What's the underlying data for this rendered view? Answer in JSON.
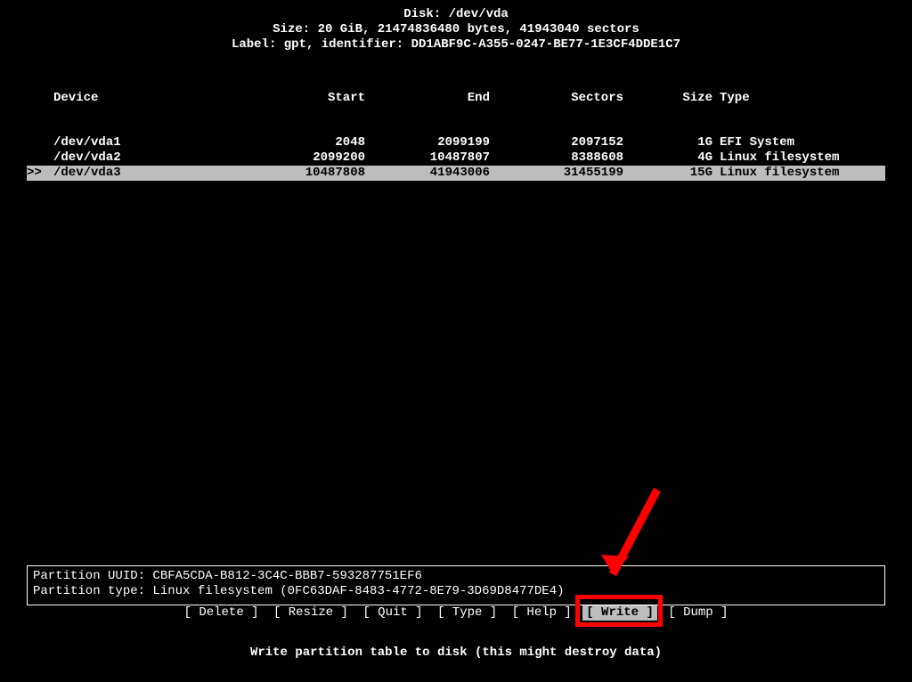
{
  "header": {
    "disk_line": "Disk: /dev/vda",
    "size_line": "Size: 20 GiB, 21474836480 bytes, 41943040 sectors",
    "label_line": "Label: gpt, identifier: DD1ABF9C-A355-0247-BE77-1E3CF4DDE1C7"
  },
  "columns": {
    "device": "Device",
    "start": "Start",
    "end": "End",
    "sectors": "Sectors",
    "size": "Size",
    "type": "Type"
  },
  "partitions": [
    {
      "cursor": "",
      "device": "/dev/vda1",
      "start": "2048",
      "end": "2099199",
      "sectors": "2097152",
      "size": "1G",
      "type": "EFI System",
      "selected": false
    },
    {
      "cursor": "",
      "device": "/dev/vda2",
      "start": "2099200",
      "end": "10487807",
      "sectors": "8388608",
      "size": "4G",
      "type": "Linux filesystem",
      "selected": false
    },
    {
      "cursor": ">>",
      "device": "/dev/vda3",
      "start": "10487808",
      "end": "41943006",
      "sectors": "31455199",
      "size": "15G",
      "type": "Linux filesystem",
      "selected": true
    }
  ],
  "info": {
    "uuid_line": "Partition UUID: CBFA5CDA-B812-3C4C-BBB7-593287751EF6",
    "type_line": "Partition type: Linux filesystem (0FC63DAF-8483-4772-8E79-3D69D8477DE4)"
  },
  "menu": {
    "items": [
      {
        "label": "[ Delete ]",
        "selected": false
      },
      {
        "label": "[ Resize ]",
        "selected": false
      },
      {
        "label": "[  Quit  ]",
        "selected": false
      },
      {
        "label": "[  Type  ]",
        "selected": false
      },
      {
        "label": "[  Help  ]",
        "selected": false
      },
      {
        "label": "[  Write ]",
        "selected": true
      },
      {
        "label": "[  Dump  ]",
        "selected": false
      }
    ]
  },
  "hint": "Write partition table to disk (this might destroy data)"
}
